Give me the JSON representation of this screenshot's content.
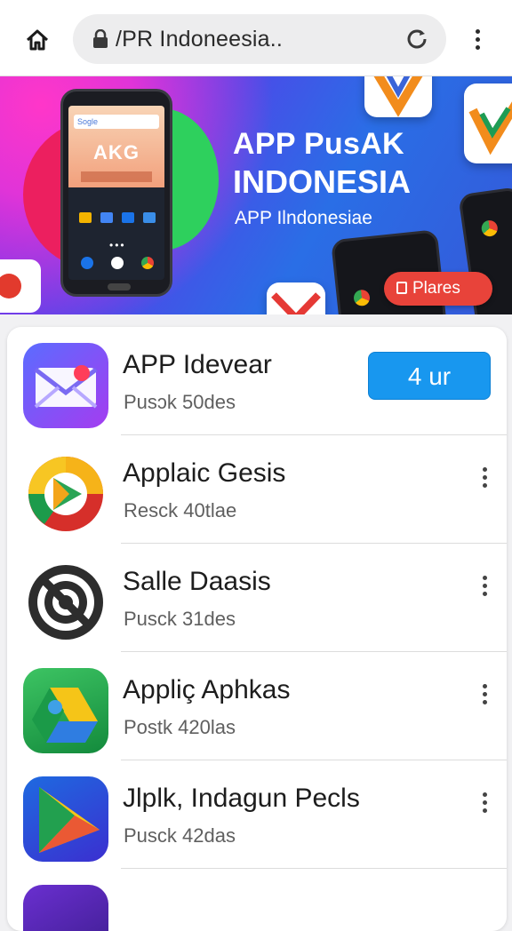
{
  "browser": {
    "url": "/PR Indoneesia..",
    "home_icon": "home-icon",
    "lock_icon": "lock-icon",
    "reload_icon": "reload-icon",
    "menu_icon": "more-vert-icon"
  },
  "hero": {
    "title_line1": "APP PusAK",
    "title_line2": "INDONESIA",
    "subtitle": "APP Ilndonesiae",
    "button_label": "Plares",
    "phone_screen_title": "AKG",
    "phone_search": "Sogle"
  },
  "apps": [
    {
      "name": "APP Idevear",
      "meta": "Pusɔk  50des",
      "action": "4 ur",
      "icon": "mail-icon"
    },
    {
      "name": "Applaic Gesis",
      "meta": "Resck  40tlae",
      "icon": "play-store-icon"
    },
    {
      "name": "Salle Daasis",
      "meta": "Pusck  31des",
      "icon": "radar-icon"
    },
    {
      "name": "Appliç Aphkas",
      "meta": "Postk  420las",
      "icon": "drive-icon"
    },
    {
      "name": "Jlplk, Indagun Pecls",
      "meta": "Pusck  42das",
      "icon": "play-triangle-icon"
    }
  ],
  "colors": {
    "install_button": "#1897ef",
    "hero_cta": "#e8433a",
    "hero_background": "#3a5ae4"
  }
}
